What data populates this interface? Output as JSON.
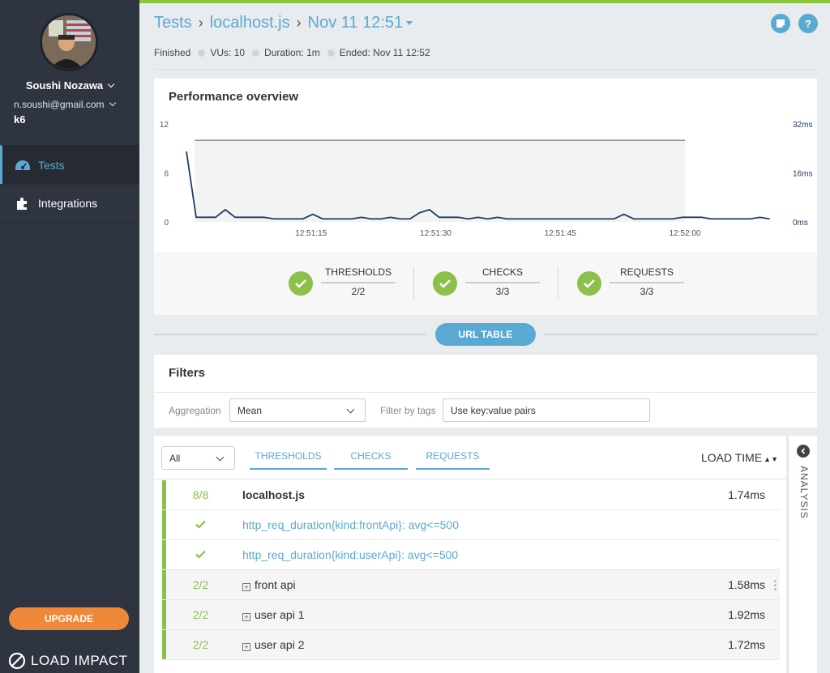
{
  "sidebar": {
    "user_name": "Soushi Nozawa",
    "user_email": "n.soushi@gmail.com",
    "org": "k6",
    "nav": [
      {
        "label": "Tests",
        "icon": "dashboard-gauge-icon",
        "active": true
      },
      {
        "label": "Integrations",
        "icon": "puzzle-piece-icon",
        "active": false
      }
    ],
    "upgrade_label": "UPGRADE",
    "brand": "LOAD IMPACT"
  },
  "header": {
    "breadcrumb": [
      "Tests",
      "localhost.js",
      "Nov 11 12:51"
    ],
    "status": "Finished",
    "vus": "VUs: 10",
    "duration": "Duration: 1m",
    "ended": "Ended: Nov 11 12:52",
    "help_label": "?"
  },
  "performance": {
    "title": "Performance overview",
    "summary": [
      {
        "label": "THRESHOLDS",
        "value": "2/2"
      },
      {
        "label": "CHECKS",
        "value": "3/3"
      },
      {
        "label": "REQUESTS",
        "value": "3/3"
      }
    ]
  },
  "chart_data": {
    "type": "line",
    "title": "",
    "xlabel": "",
    "ylabel": "",
    "y_left_ticks": [
      "12",
      "6",
      "0"
    ],
    "y_right_ticks": [
      "32ms",
      "16ms",
      "0ms"
    ],
    "x_ticks": [
      "12:51:15",
      "12:51:30",
      "12:51:45",
      "12:52:00"
    ],
    "ylim_left": [
      0,
      12
    ],
    "ylim_right": [
      0,
      32
    ],
    "grid": false,
    "series": [
      {
        "color": "#1f3d63",
        "axis": "right",
        "x": [
          0,
          1,
          2,
          3,
          4,
          5,
          6,
          7,
          8,
          9,
          10,
          11,
          12,
          13,
          14,
          15,
          16,
          17,
          18,
          19,
          20,
          21,
          22,
          23,
          24,
          25,
          26,
          27,
          28,
          29,
          30,
          31,
          32,
          33,
          34,
          35,
          35.5,
          36,
          37,
          38,
          39,
          40,
          41,
          42,
          43,
          44,
          45,
          46,
          47,
          48,
          49,
          50,
          51,
          52,
          53,
          54,
          55,
          56,
          57,
          58,
          59,
          60
        ],
        "y": [
          23,
          1.5,
          1.5,
          1.5,
          4,
          1.5,
          1.5,
          1.5,
          1.5,
          1,
          1,
          1,
          1,
          2.5,
          1,
          1,
          1,
          1,
          1.5,
          1,
          1,
          1.5,
          1,
          1,
          3,
          4,
          1.5,
          1.5,
          1.5,
          1,
          1.5,
          1,
          1.5,
          1,
          1,
          1,
          1,
          1,
          1,
          1,
          1,
          1,
          1,
          1,
          1,
          1,
          2.5,
          1,
          1,
          1,
          1,
          1,
          1.5,
          1.5,
          1.5,
          1,
          1,
          1,
          1,
          1,
          1.5,
          1
        ]
      },
      {
        "color": "#888888",
        "axis": "left",
        "x": [
          1,
          60
        ],
        "y": [
          10,
          10
        ]
      }
    ]
  },
  "divider": {
    "url_table_label": "URL TABLE"
  },
  "filters": {
    "title": "Filters",
    "aggregation_label": "Aggregation",
    "aggregation_value": "Mean",
    "tags_label": "Filter by tags",
    "tags_placeholder": "Use key:value pairs"
  },
  "table": {
    "scope_value": "All",
    "tabs": [
      "THRESHOLDS",
      "CHECKS",
      "REQUESTS"
    ],
    "sort_label": "LOAD TIME",
    "rows": [
      {
        "count": "8/8",
        "name": "localhost.js",
        "time": "1.74ms"
      },
      {
        "count": "",
        "name": "http_req_duration{kind:frontApi}: avg<=500",
        "time": ""
      },
      {
        "count": "",
        "name": "http_req_duration{kind:userApi}: avg<=500",
        "time": ""
      },
      {
        "count": "2/2",
        "name": "front api",
        "time": "1.58ms"
      },
      {
        "count": "2/2",
        "name": "user api 1",
        "time": "1.92ms"
      },
      {
        "count": "2/2",
        "name": "user api 2",
        "time": "1.72ms"
      }
    ],
    "analysis_label": "ANALYSIS"
  },
  "colors": {
    "accent": "#5aa9d2",
    "success": "#8bc04a",
    "upgrade": "#f0883a",
    "sidebar_bg": "#2e3440"
  }
}
